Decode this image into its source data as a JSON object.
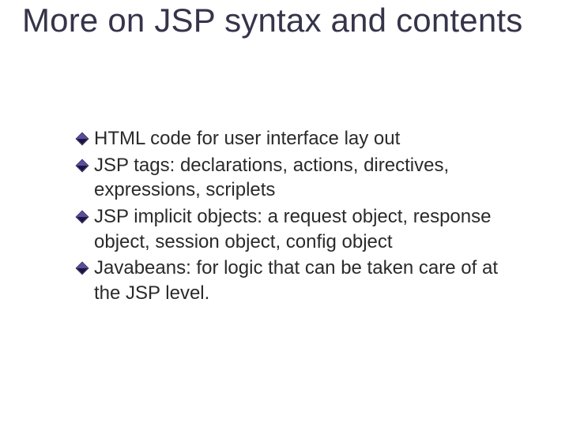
{
  "title": "More on JSP syntax and contents",
  "items": [
    "HTML code for user interface lay out",
    "JSP tags: declarations, actions, directives, expressions, scriplets",
    "JSP implicit objects: a request object, response object, session object, config object",
    "Javabeans: for logic that can be taken care of at the JSP level."
  ]
}
